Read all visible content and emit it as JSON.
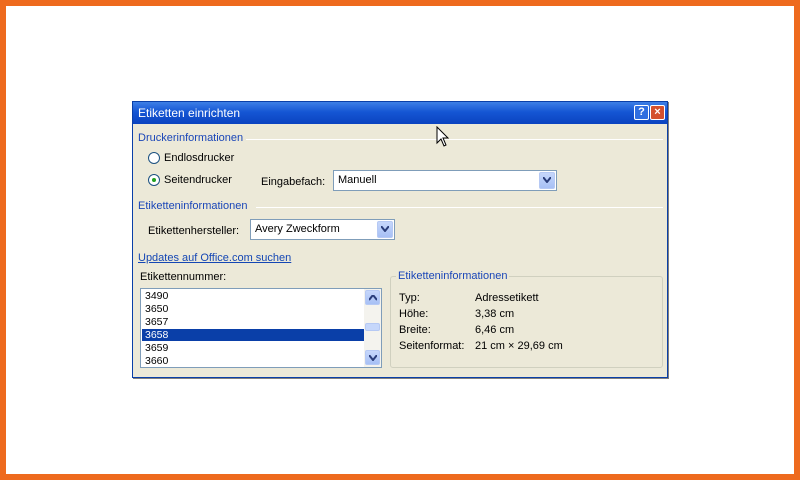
{
  "dialog": {
    "title": "Etiketten einrichten",
    "help_glyph": "?",
    "close_glyph": "×"
  },
  "printer_info": {
    "heading": "Druckerinformationen",
    "option_continuous": "Endlosdrucker",
    "option_page": "Seitendrucker",
    "selected": "Seitendrucker",
    "tray_label": "Eingabefach:",
    "tray_value": "Manuell"
  },
  "label_info": {
    "heading": "Etiketteninformationen",
    "manufacturer_label": "Etikettenhersteller:",
    "manufacturer_value": "Avery Zweckform",
    "updates_link": "Updates auf Office.com suchen",
    "number_label": "Etikettennummer:",
    "numbers": [
      "3490",
      "3650",
      "3657",
      "3658",
      "3659",
      "3660"
    ],
    "selected_number": "3658"
  },
  "details": {
    "heading": "Etiketteninformationen",
    "rows": [
      {
        "key": "Typ:",
        "value": "Adressetikett"
      },
      {
        "key": "Höhe:",
        "value": "3,38 cm"
      },
      {
        "key": "Breite:",
        "value": "6,46 cm"
      },
      {
        "key": "Seitenformat:",
        "value": "21 cm × 29,69 cm"
      }
    ]
  },
  "colors": {
    "frame": "#ee6a1e",
    "titlebar": "#1556d4",
    "selection": "#0a3fa8",
    "group_heading": "#1a46b8"
  }
}
